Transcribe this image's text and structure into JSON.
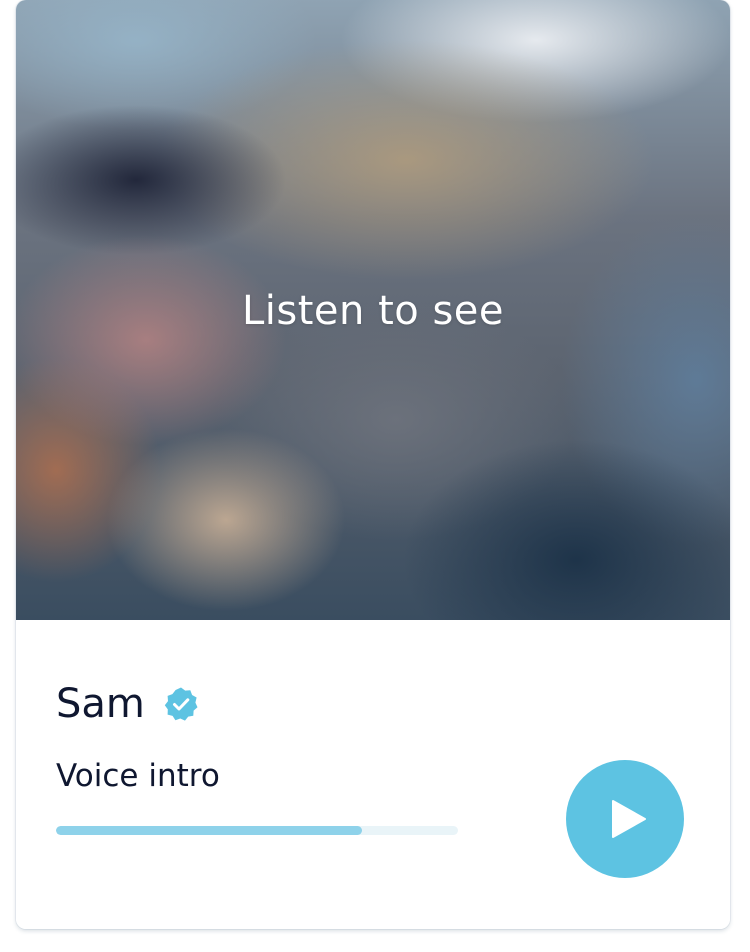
{
  "card": {
    "overlay_text": "Listen to see",
    "profile": {
      "name": "Sam",
      "verified": true
    },
    "voice_intro": {
      "label": "Voice intro",
      "progress": 0.76
    }
  },
  "icons": {
    "verified": "verified-badge-icon",
    "play": "play-icon"
  },
  "colors": {
    "accent": "#5dc3e2",
    "progress_fill": "#8ed2ea",
    "progress_track": "#e9f4f8",
    "text": "#0f1730"
  }
}
